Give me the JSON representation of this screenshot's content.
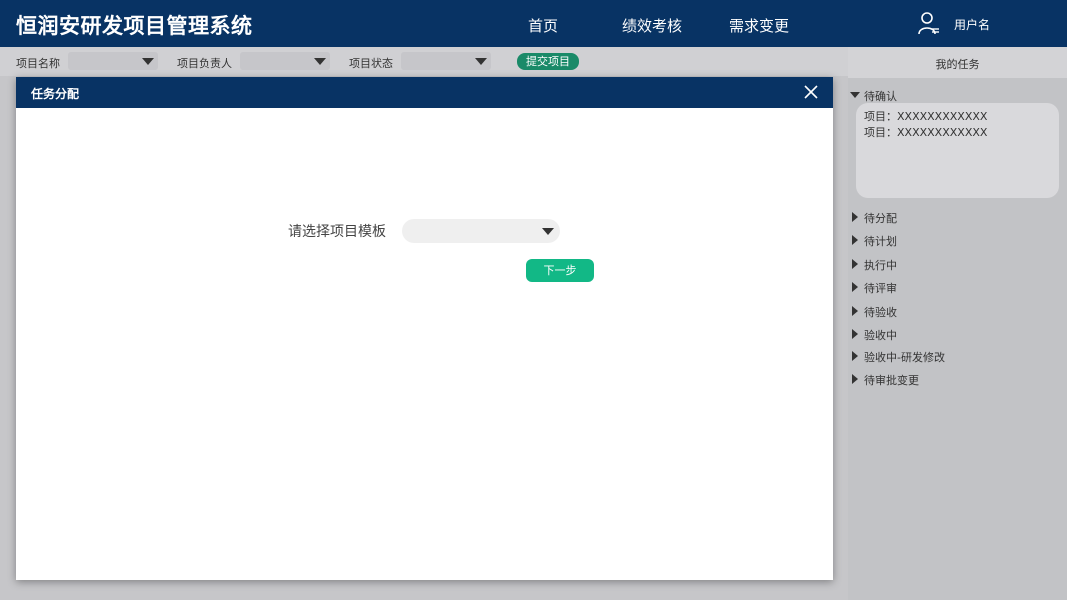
{
  "header": {
    "app_title": "恒润安研发项目管理系统",
    "nav": [
      "首页",
      "绩效考核",
      "需求变更"
    ],
    "user_name": "用户名"
  },
  "filters": {
    "project_name_label": "项目名称",
    "owner_label": "项目负责人",
    "status_label": "项目状态",
    "submit_label": "提交项目"
  },
  "right_panel": {
    "title": "我的任务",
    "expanded": {
      "label": "待确认",
      "items": [
        "项目：XXXXXXXXXXXX",
        "项目：XXXXXXXXXXXX"
      ]
    },
    "collapsed": [
      "待分配",
      "待计划",
      "执行中",
      "待评审",
      "待验收",
      "验收中",
      "验收中-研发修改",
      "待审批变更"
    ]
  },
  "modal": {
    "title": "任务分配",
    "template_label": "请选择项目模板",
    "template_value": "",
    "next_label": "下一步"
  },
  "colors": {
    "header_bg": "#083364",
    "accent_green": "#12b886",
    "submit_green": "#1a8a68"
  }
}
